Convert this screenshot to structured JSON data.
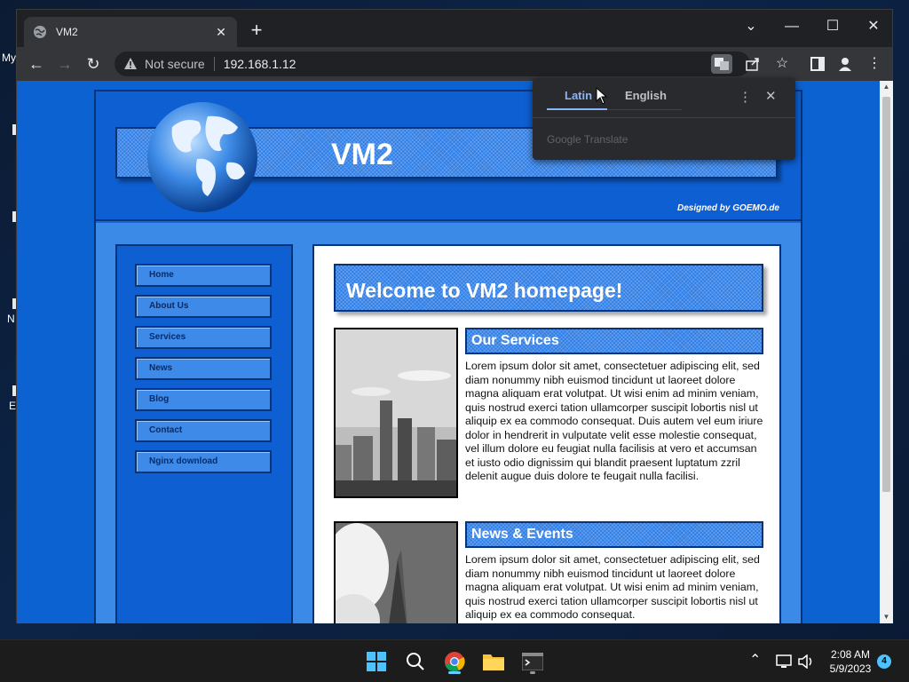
{
  "desktop": {
    "icon_labels": [
      "My",
      "N",
      "E"
    ]
  },
  "browser": {
    "tab": {
      "title": "VM2"
    },
    "address": {
      "security_label": "Not secure",
      "url": "192.168.1.12"
    }
  },
  "site": {
    "header_title": "VM2",
    "designed_by": "Designed by GOEMO.de",
    "nav": [
      "Home",
      "About Us",
      "Services",
      "News",
      "Blog",
      "Contact",
      "Nginx download"
    ],
    "welcome": "Welcome to VM2 homepage!",
    "sections": [
      {
        "heading": "Our Services",
        "text": "Lorem ipsum dolor sit amet, consectetuer adipiscing elit, sed diam nonummy nibh euismod tincidunt ut laoreet dolore magna aliquam erat volutpat. Ut wisi enim ad minim veniam, quis nostrud exerci tation ullamcorper suscipit lobortis nisl ut aliquip ex ea commodo consequat. Duis autem vel eum iriure dolor in hendrerit in vulputate velit esse molestie consequat, vel illum dolore eu feugiat nulla facilisis at vero et accumsan et iusto odio dignissim qui blandit praesent luptatum zzril delenit augue duis dolore te feugait nulla facilisi."
      },
      {
        "heading": "News & Events",
        "text": "Lorem ipsum dolor sit amet, consectetuer adipiscing elit, sed diam nonummy nibh euismod tincidunt ut laoreet dolore magna aliquam erat volutpat. Ut wisi enim ad minim veniam, quis nostrud exerci tation ullamcorper suscipit lobortis nisl ut aliquip ex ea commodo consequat."
      }
    ]
  },
  "translate_popup": {
    "source_lang": "Latin",
    "target_lang": "English",
    "footer": "Google Translate"
  },
  "taskbar": {
    "time": "2:08 AM",
    "date": "5/9/2023",
    "notification_count": "4"
  },
  "colors": {
    "page_blue": "#0b62d0",
    "accent_underline": "#8ab4f8"
  }
}
